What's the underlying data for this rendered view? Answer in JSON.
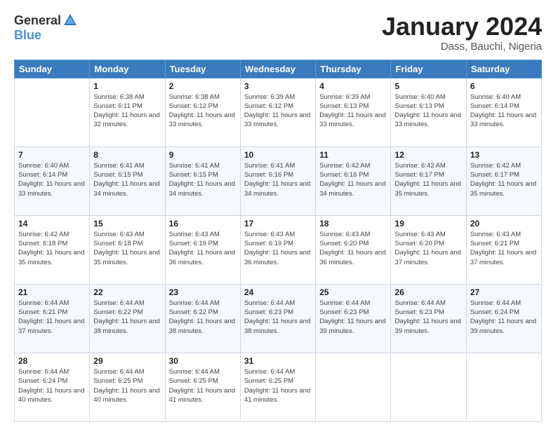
{
  "logo": {
    "general": "General",
    "blue": "Blue"
  },
  "header": {
    "month_title": "January 2024",
    "location": "Dass, Bauchi, Nigeria"
  },
  "days_of_week": [
    "Sunday",
    "Monday",
    "Tuesday",
    "Wednesday",
    "Thursday",
    "Friday",
    "Saturday"
  ],
  "weeks": [
    [
      {
        "day": "",
        "sunrise": "",
        "sunset": "",
        "daylight": ""
      },
      {
        "day": "1",
        "sunrise": "Sunrise: 6:38 AM",
        "sunset": "Sunset: 6:11 PM",
        "daylight": "Daylight: 11 hours and 32 minutes."
      },
      {
        "day": "2",
        "sunrise": "Sunrise: 6:38 AM",
        "sunset": "Sunset: 6:12 PM",
        "daylight": "Daylight: 11 hours and 33 minutes."
      },
      {
        "day": "3",
        "sunrise": "Sunrise: 6:39 AM",
        "sunset": "Sunset: 6:12 PM",
        "daylight": "Daylight: 11 hours and 33 minutes."
      },
      {
        "day": "4",
        "sunrise": "Sunrise: 6:39 AM",
        "sunset": "Sunset: 6:13 PM",
        "daylight": "Daylight: 11 hours and 33 minutes."
      },
      {
        "day": "5",
        "sunrise": "Sunrise: 6:40 AM",
        "sunset": "Sunset: 6:13 PM",
        "daylight": "Daylight: 11 hours and 33 minutes."
      },
      {
        "day": "6",
        "sunrise": "Sunrise: 6:40 AM",
        "sunset": "Sunset: 6:14 PM",
        "daylight": "Daylight: 11 hours and 33 minutes."
      }
    ],
    [
      {
        "day": "7",
        "sunrise": "Sunrise: 6:40 AM",
        "sunset": "Sunset: 6:14 PM",
        "daylight": "Daylight: 11 hours and 33 minutes."
      },
      {
        "day": "8",
        "sunrise": "Sunrise: 6:41 AM",
        "sunset": "Sunset: 6:15 PM",
        "daylight": "Daylight: 11 hours and 34 minutes."
      },
      {
        "day": "9",
        "sunrise": "Sunrise: 6:41 AM",
        "sunset": "Sunset: 6:15 PM",
        "daylight": "Daylight: 11 hours and 34 minutes."
      },
      {
        "day": "10",
        "sunrise": "Sunrise: 6:41 AM",
        "sunset": "Sunset: 6:16 PM",
        "daylight": "Daylight: 11 hours and 34 minutes."
      },
      {
        "day": "11",
        "sunrise": "Sunrise: 6:42 AM",
        "sunset": "Sunset: 6:16 PM",
        "daylight": "Daylight: 11 hours and 34 minutes."
      },
      {
        "day": "12",
        "sunrise": "Sunrise: 6:42 AM",
        "sunset": "Sunset: 6:17 PM",
        "daylight": "Daylight: 11 hours and 35 minutes."
      },
      {
        "day": "13",
        "sunrise": "Sunrise: 6:42 AM",
        "sunset": "Sunset: 6:17 PM",
        "daylight": "Daylight: 11 hours and 35 minutes."
      }
    ],
    [
      {
        "day": "14",
        "sunrise": "Sunrise: 6:42 AM",
        "sunset": "Sunset: 6:18 PM",
        "daylight": "Daylight: 11 hours and 35 minutes."
      },
      {
        "day": "15",
        "sunrise": "Sunrise: 6:43 AM",
        "sunset": "Sunset: 6:18 PM",
        "daylight": "Daylight: 11 hours and 35 minutes."
      },
      {
        "day": "16",
        "sunrise": "Sunrise: 6:43 AM",
        "sunset": "Sunset: 6:19 PM",
        "daylight": "Daylight: 11 hours and 36 minutes."
      },
      {
        "day": "17",
        "sunrise": "Sunrise: 6:43 AM",
        "sunset": "Sunset: 6:19 PM",
        "daylight": "Daylight: 11 hours and 36 minutes."
      },
      {
        "day": "18",
        "sunrise": "Sunrise: 6:43 AM",
        "sunset": "Sunset: 6:20 PM",
        "daylight": "Daylight: 11 hours and 36 minutes."
      },
      {
        "day": "19",
        "sunrise": "Sunrise: 6:43 AM",
        "sunset": "Sunset: 6:20 PM",
        "daylight": "Daylight: 11 hours and 37 minutes."
      },
      {
        "day": "20",
        "sunrise": "Sunrise: 6:43 AM",
        "sunset": "Sunset: 6:21 PM",
        "daylight": "Daylight: 11 hours and 37 minutes."
      }
    ],
    [
      {
        "day": "21",
        "sunrise": "Sunrise: 6:44 AM",
        "sunset": "Sunset: 6:21 PM",
        "daylight": "Daylight: 11 hours and 37 minutes."
      },
      {
        "day": "22",
        "sunrise": "Sunrise: 6:44 AM",
        "sunset": "Sunset: 6:22 PM",
        "daylight": "Daylight: 11 hours and 38 minutes."
      },
      {
        "day": "23",
        "sunrise": "Sunrise: 6:44 AM",
        "sunset": "Sunset: 6:22 PM",
        "daylight": "Daylight: 11 hours and 38 minutes."
      },
      {
        "day": "24",
        "sunrise": "Sunrise: 6:44 AM",
        "sunset": "Sunset: 6:23 PM",
        "daylight": "Daylight: 11 hours and 38 minutes."
      },
      {
        "day": "25",
        "sunrise": "Sunrise: 6:44 AM",
        "sunset": "Sunset: 6:23 PM",
        "daylight": "Daylight: 11 hours and 39 minutes."
      },
      {
        "day": "26",
        "sunrise": "Sunrise: 6:44 AM",
        "sunset": "Sunset: 6:23 PM",
        "daylight": "Daylight: 11 hours and 39 minutes."
      },
      {
        "day": "27",
        "sunrise": "Sunrise: 6:44 AM",
        "sunset": "Sunset: 6:24 PM",
        "daylight": "Daylight: 11 hours and 39 minutes."
      }
    ],
    [
      {
        "day": "28",
        "sunrise": "Sunrise: 6:44 AM",
        "sunset": "Sunset: 6:24 PM",
        "daylight": "Daylight: 11 hours and 40 minutes."
      },
      {
        "day": "29",
        "sunrise": "Sunrise: 6:44 AM",
        "sunset": "Sunset: 6:25 PM",
        "daylight": "Daylight: 11 hours and 40 minutes."
      },
      {
        "day": "30",
        "sunrise": "Sunrise: 6:44 AM",
        "sunset": "Sunset: 6:25 PM",
        "daylight": "Daylight: 11 hours and 41 minutes."
      },
      {
        "day": "31",
        "sunrise": "Sunrise: 6:44 AM",
        "sunset": "Sunset: 6:25 PM",
        "daylight": "Daylight: 11 hours and 41 minutes."
      },
      {
        "day": "",
        "sunrise": "",
        "sunset": "",
        "daylight": ""
      },
      {
        "day": "",
        "sunrise": "",
        "sunset": "",
        "daylight": ""
      },
      {
        "day": "",
        "sunrise": "",
        "sunset": "",
        "daylight": ""
      }
    ]
  ]
}
